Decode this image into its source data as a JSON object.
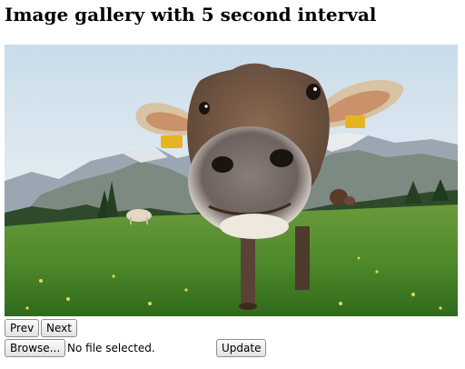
{
  "page": {
    "title": "Image gallery with 5 second interval"
  },
  "gallery": {
    "image_subject": "cow close-up in alpine meadow",
    "controls": {
      "prev_label": "Prev",
      "next_label": "Next"
    }
  },
  "upload": {
    "browse_label": "Browse...",
    "file_status": "No file selected.",
    "update_label": "Update"
  }
}
